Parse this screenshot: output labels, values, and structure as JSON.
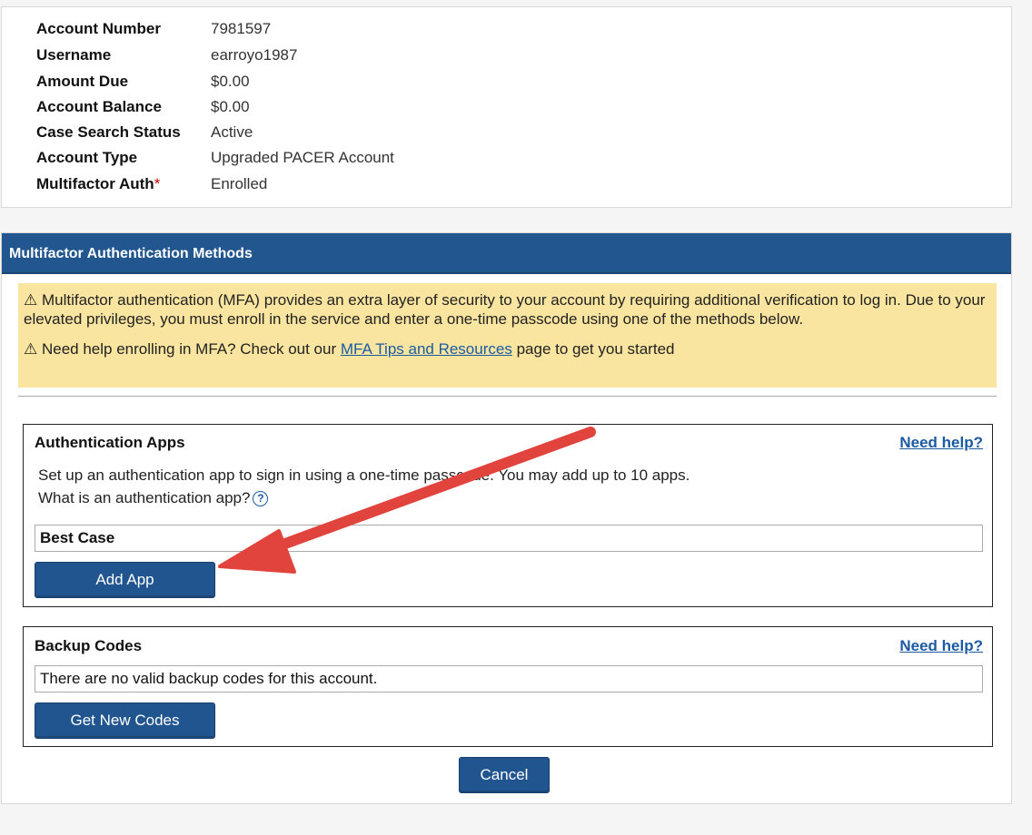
{
  "account": {
    "rows": [
      {
        "label": "Account Number",
        "value": "7981597"
      },
      {
        "label": "Username",
        "value": "earroyo1987"
      },
      {
        "label": "Amount Due",
        "value": "$0.00"
      },
      {
        "label": "Account Balance",
        "value": "$0.00"
      },
      {
        "label": "Case Search Status",
        "value": "Active"
      },
      {
        "label": "Account Type",
        "value": "Upgraded PACER Account"
      },
      {
        "label": "Multifactor Auth",
        "value": "Enrolled",
        "required_mark": "*"
      }
    ]
  },
  "mfa": {
    "header": "Multifactor Authentication Methods",
    "warning_icon": "warning-triangle-icon",
    "warning_symbol": "⚠",
    "warning_text": "Multifactor authentication (MFA) provides an extra layer of security to your account by requiring additional verification to log in. Due to your elevated privileges, you must enroll in the service and enter a one-time passcode using one of the methods below.",
    "help_text_before": "Need help enrolling in MFA? Check out our",
    "help_link": "MFA Tips and Resources",
    "help_text_after": "page to get you started",
    "auth_apps": {
      "title": "Authentication Apps",
      "need_help": "Need help?",
      "description": "Set up an authentication app to sign in using a one-time passcode. You may add up to 10 apps.",
      "question": "What is an authentication app?",
      "help_icon": "?",
      "app_name": "Best Case",
      "add_button": "Add App"
    },
    "backup_codes": {
      "title": "Backup Codes",
      "need_help": "Need help?",
      "message": "There are no valid backup codes for this account.",
      "get_button": "Get New Codes"
    },
    "cancel_button": "Cancel"
  },
  "colors": {
    "header_blue": "#21568f",
    "warning_bg": "#fae5a0",
    "link_blue": "#1b5aa3",
    "annotation_arrow": "#e0443d"
  }
}
